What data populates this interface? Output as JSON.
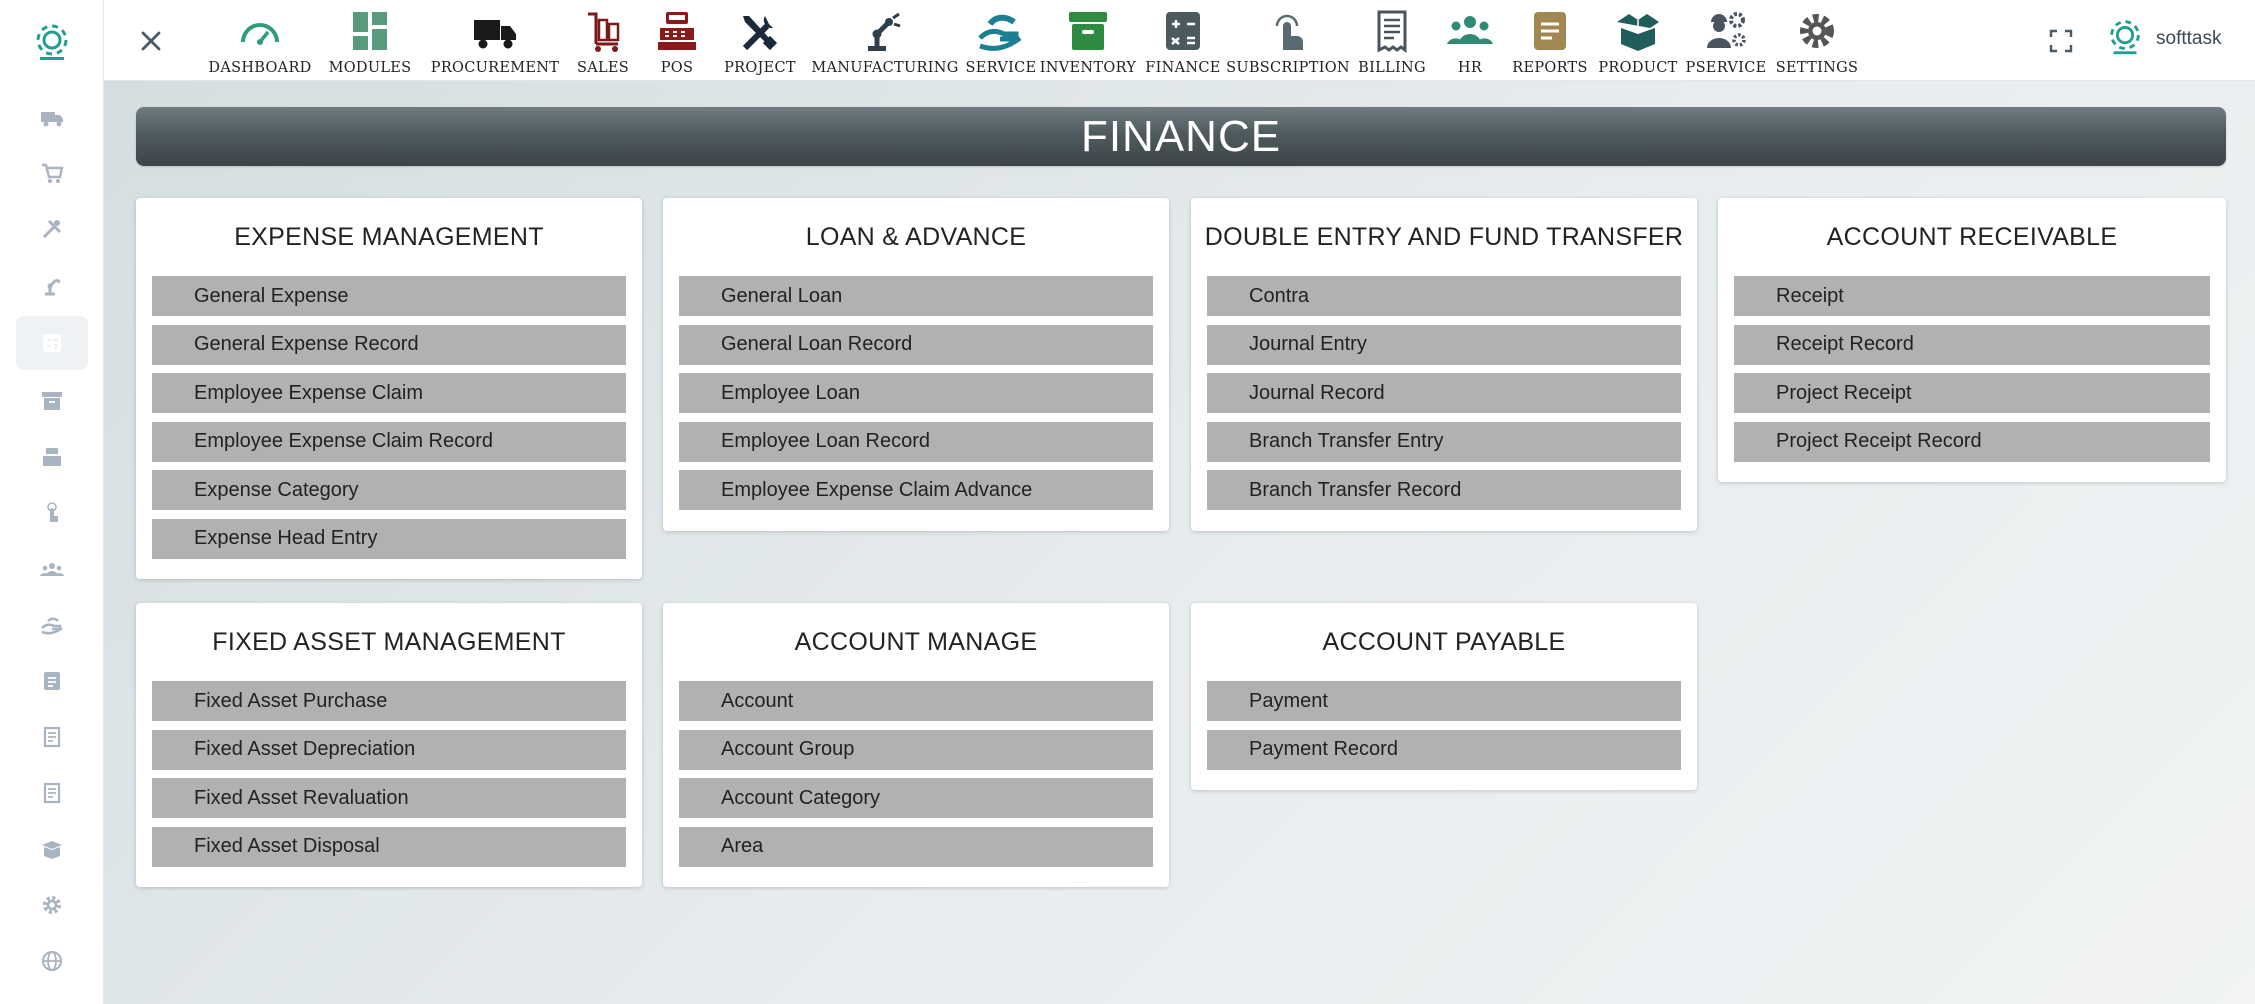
{
  "topbar": {
    "nav": [
      {
        "label": "DASHBOARD",
        "icon": "gauge-icon",
        "color": "#2e9e74"
      },
      {
        "label": "MODULES",
        "icon": "grid-icon",
        "color": "#5a9a7c"
      },
      {
        "label": "PROCUREMENT",
        "icon": "truck-icon",
        "color": "#1a1a1a"
      },
      {
        "label": "SALES",
        "icon": "cart-icon",
        "color": "#7a1a1a"
      },
      {
        "label": "POS",
        "icon": "cash-register-icon",
        "color": "#8a1a1a"
      },
      {
        "label": "PROJECT",
        "icon": "tools-icon",
        "color": "#1a2a3a"
      },
      {
        "label": "MANUFACTURING",
        "icon": "robot-arm-icon",
        "color": "#2f3f4a"
      },
      {
        "label": "SERVICE",
        "icon": "hand-service-icon",
        "color": "#1a7f93"
      },
      {
        "label": "INVENTORY",
        "icon": "archive-box-icon",
        "color": "#2e8b3f"
      },
      {
        "label": "FINANCE",
        "icon": "calculator-icon",
        "color": "#4a5a5f"
      },
      {
        "label": "SUBSCRIPTION",
        "icon": "touch-icon",
        "color": "#5a6a72"
      },
      {
        "label": "BILLING",
        "icon": "receipt-icon",
        "color": "#4a5560"
      },
      {
        "label": "HR",
        "icon": "people-icon",
        "color": "#2f8a73"
      },
      {
        "label": "REPORTS",
        "icon": "report-icon",
        "color": "#a38752"
      },
      {
        "label": "PRODUCT",
        "icon": "open-box-icon",
        "color": "#1f5e5a"
      },
      {
        "label": "PSERVICE",
        "icon": "worker-gear-icon",
        "color": "#4a5560"
      },
      {
        "label": "SETTINGS",
        "icon": "gear-icon",
        "color": "#555555"
      }
    ],
    "user_name": "softtask"
  },
  "page_title": "FINANCE",
  "cards": [
    {
      "title": "EXPENSE MANAGEMENT",
      "items": [
        "General Expense",
        "General Expense Record",
        "Employee Expense Claim",
        "Employee Expense Claim Record",
        "Expense Category",
        "Expense Head Entry"
      ]
    },
    {
      "title": "LOAN & ADVANCE",
      "items": [
        "General Loan",
        "General Loan Record",
        "Employee Loan",
        "Employee Loan Record",
        "Employee Expense Claim Advance"
      ]
    },
    {
      "title": "DOUBLE ENTRY AND FUND TRANSFER",
      "items": [
        "Contra",
        "Journal Entry",
        "Journal Record",
        "Branch Transfer Entry",
        "Branch Transfer Record"
      ]
    },
    {
      "title": "ACCOUNT RECEIVABLE",
      "items": [
        "Receipt",
        "Receipt Record",
        "Project Receipt",
        "Project Receipt Record"
      ]
    },
    {
      "title": "FIXED ASSET MANAGEMENT",
      "items": [
        "Fixed Asset Purchase",
        "Fixed Asset Depreciation",
        "Fixed Asset Revaluation",
        "Fixed Asset Disposal"
      ]
    },
    {
      "title": "ACCOUNT MANAGE",
      "items": [
        "Account",
        "Account Group",
        "Account Category",
        "Area"
      ]
    },
    {
      "title": "ACCOUNT PAYABLE",
      "items": [
        "Payment",
        "Payment Record"
      ]
    }
  ]
}
